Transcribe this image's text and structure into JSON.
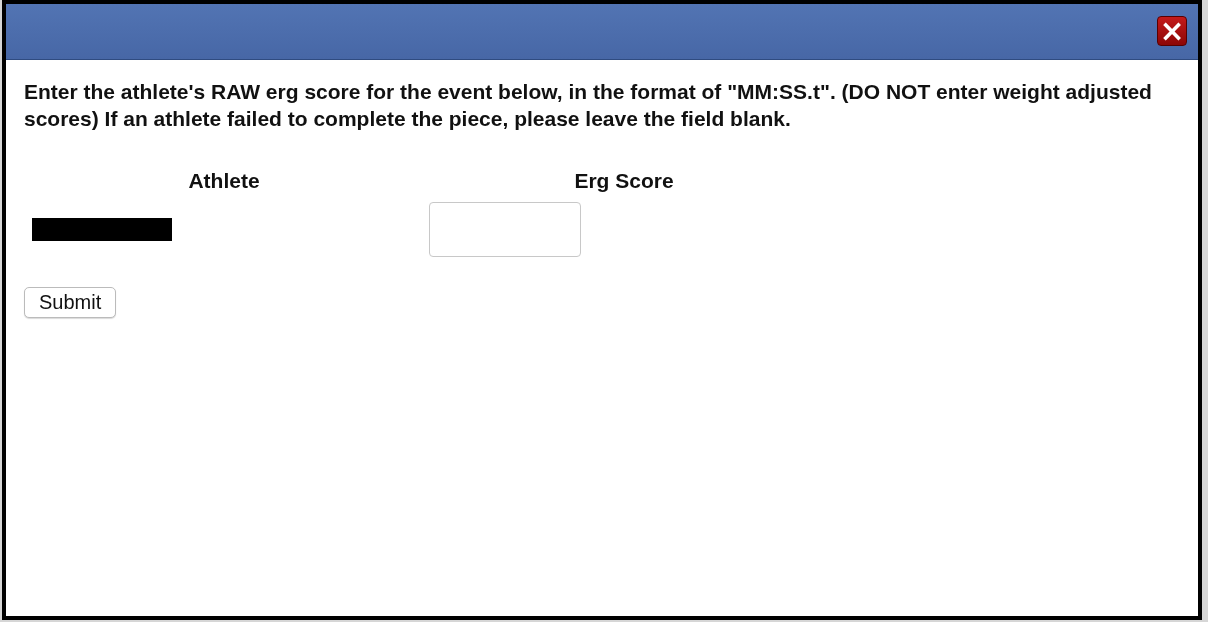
{
  "dialog": {
    "close_button": {
      "label": "×"
    }
  },
  "instructions": "Enter the athlete's RAW erg score for the event below, in the format of \"MM:SS.t\". (DO NOT enter weight adjusted scores) If an athlete failed to complete the piece, please leave the field blank.",
  "table": {
    "columns": [
      "Athlete",
      "Erg Score"
    ],
    "rows": [
      {
        "athlete": {
          "redacted": true
        }
      }
    ]
  },
  "buttons": [
    "Submit"
  ]
}
